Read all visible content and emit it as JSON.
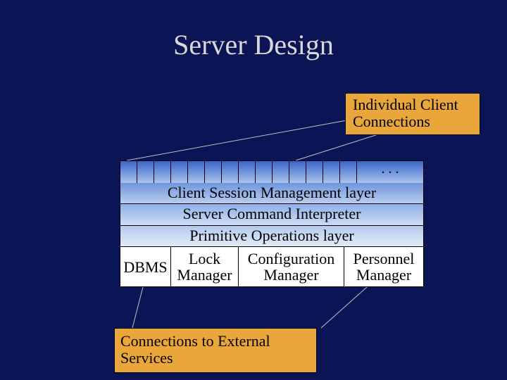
{
  "title": "Server Design",
  "callouts": {
    "top": "Individual Client Connections",
    "bottom": "Connections to External Services"
  },
  "ports": {
    "ellipsis": ". . ."
  },
  "layers": {
    "l1": "Client Session Management layer",
    "l2": "Server Command Interpreter",
    "l3": "Primitive Operations layer"
  },
  "managers": {
    "dbms": "DBMS",
    "lock": "Lock Manager",
    "config": "Configuration Manager",
    "personnel": "Personnel Manager"
  }
}
